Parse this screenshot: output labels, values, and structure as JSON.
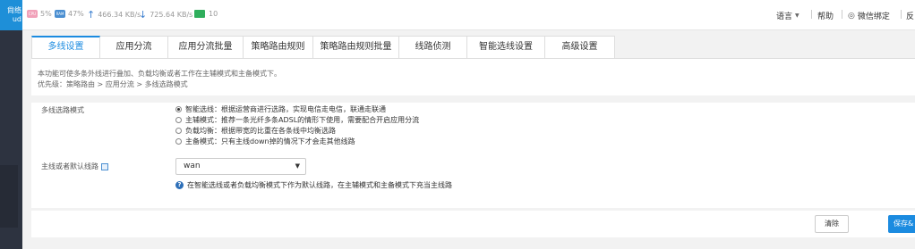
{
  "sidebar": {
    "logo_line1": "尙络",
    "logo_line2": "ud"
  },
  "topbar": {
    "cpu_badge": "CPU",
    "cpu_value": "5%",
    "ram_badge": "RAM",
    "ram_value": "47%",
    "upload": "466.34 KB/s",
    "download": "725.64 KB/s",
    "online_count": "10",
    "language": "语言",
    "help": "帮助",
    "wechat": "微信绑定",
    "feedback": "反"
  },
  "tabs": [
    {
      "label": "多线设置",
      "active": true
    },
    {
      "label": "应用分流"
    },
    {
      "label": "应用分流批量"
    },
    {
      "label": "策略路由规则"
    },
    {
      "label": "策略路由规则批量"
    },
    {
      "label": "线路侦测"
    },
    {
      "label": "智能选线设置"
    },
    {
      "label": "高级设置"
    }
  ],
  "panel": {
    "description": "本功能可使多条外线进行叠加、负载均衡或者工作在主辅模式和主备模式下。",
    "priority": "优先级：策略路由 > 应用分流 > 多线选路模式",
    "mode_label": "多线选路模式",
    "modes": [
      {
        "text": "智能选线：根据运营商进行选路，实现电信走电信，联通走联通",
        "checked": true
      },
      {
        "text": "主辅模式：推荐一条光纤多条ADSL的情形下使用，需要配合开启应用分流",
        "checked": false
      },
      {
        "text": "负载均衡：根据带宽的比重在各条线中均衡选路",
        "checked": false
      },
      {
        "text": "主备模式：只有主线down掉的情况下才会走其他线路",
        "checked": false
      }
    ],
    "default_line_label": "主线或者默认线路",
    "default_line_value": "wan",
    "help_text": "在智能选线或者负载均衡模式下作为默认线路，在主辅模式和主备模式下充当主线路"
  },
  "buttons": {
    "clear": "清除",
    "save": "保存&"
  }
}
